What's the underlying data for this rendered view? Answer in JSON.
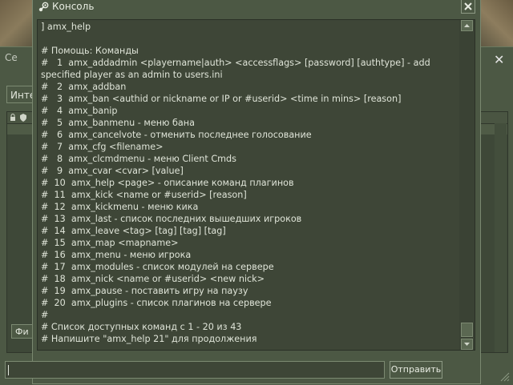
{
  "background_window": {
    "title": "Се",
    "tab_label": "Инте",
    "button_label": "Фи"
  },
  "console": {
    "title": "Консоль",
    "output_lines": [
      "] amx_help",
      "",
      "# Помощь: Команды",
      "#   1  amx_addadmin <playername|auth> <accessflags> [password] [authtype] - add",
      "specified player as an admin to users.ini",
      "#   2  amx_addban",
      "#   3  amx_ban <authid or nickname or IP or #userid> <time in mins> [reason]",
      "#   4  amx_banip",
      "#   5  amx_banmenu - меню бана",
      "#   6  amx_cancelvote - отменить последнее голосование",
      "#   7  amx_cfg <filename>",
      "#   8  amx_clcmdmenu - меню Client Cmds",
      "#   9  amx_cvar <cvar> [value]",
      "#  10  amx_help <page> - описание команд плагинов",
      "#  11  amx_kick <name or #userid> [reason]",
      "#  12  amx_kickmenu - меню кика",
      "#  13  amx_last - список последних вышедших игроков",
      "#  14  amx_leave <tag> [tag] [tag] [tag]",
      "#  15  amx_map <mapname>",
      "#  16  amx_menu - меню игрока",
      "#  17  amx_modules - список модулей на сервере",
      "#  18  amx_nick <name or #userid> <new nick>",
      "#  19  amx_pause - поставить игру на паузу",
      "#  20  amx_plugins - список плагинов на сервере",
      "#",
      "# Список доступных команд с 1 - 20 из 43",
      "# Напишите \"amx_help 21\" для продолжения"
    ],
    "input_value": "",
    "submit_label": "Отправить"
  },
  "icons": {
    "title_icon": "steam-icon",
    "close": "close-icon",
    "scroll_up": "arrow-up-icon",
    "scroll_down": "arrow-down-icon"
  },
  "colors": {
    "window_bg": "#4c5844",
    "panel_bg": "#3e4637",
    "text": "#dfe4d8",
    "border": "#7c8a72"
  }
}
